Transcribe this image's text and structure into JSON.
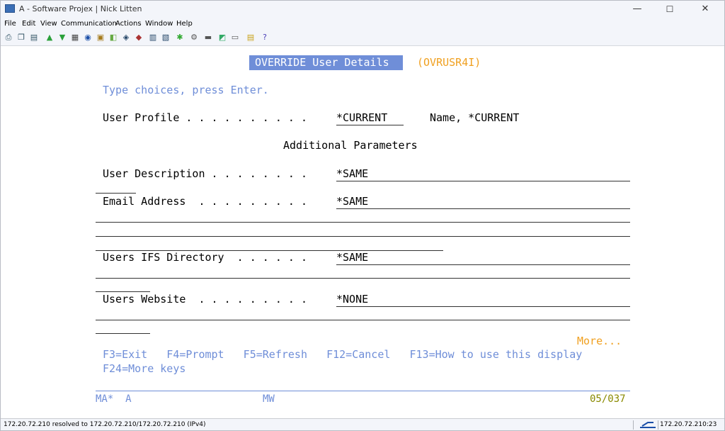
{
  "window": {
    "title": "A - Software Projex | Nick Litten"
  },
  "menu": [
    "File",
    "Edit",
    "View",
    "Communication",
    "Actions",
    "Window",
    "Help"
  ],
  "screen": {
    "panel_title": "OVERRIDE User Details",
    "panel_id": "(OVRUSR4I)",
    "instruction": "Type choices, press Enter.",
    "user_profile": {
      "label": "User Profile . . . . . . . . . .",
      "value": "*CURRENT",
      "hint": "Name, *CURRENT"
    },
    "section_heading": "Additional Parameters",
    "user_description": {
      "label": "User Description . . . . . . . .",
      "value": "*SAME"
    },
    "email_address": {
      "label": "Email Address  . . . . . . . . .",
      "value": "*SAME"
    },
    "ifs_directory": {
      "label": "Users IFS Directory  . . . . . .",
      "value": "*SAME"
    },
    "website": {
      "label": "Users Website  . . . . . . . . .",
      "value": "*NONE"
    },
    "more": "More...",
    "fkeys_line1": "F3=Exit   F4=Prompt   F5=Refresh   F12=Cancel   F13=How to use this display",
    "fkeys_line2": "F24=More keys"
  },
  "oia": {
    "left": "MA*  A",
    "mode": "MW",
    "cursor": "05/037"
  },
  "status": {
    "message": "172.20.72.210 resolved to 172.20.72.210/172.20.72.210 (IPv4)",
    "connection": "172.20.72.210:23"
  },
  "colors": {
    "field_text": "#000000",
    "prompt_blue": "#6f8ed8",
    "highlight_orange": "#f0a020"
  }
}
